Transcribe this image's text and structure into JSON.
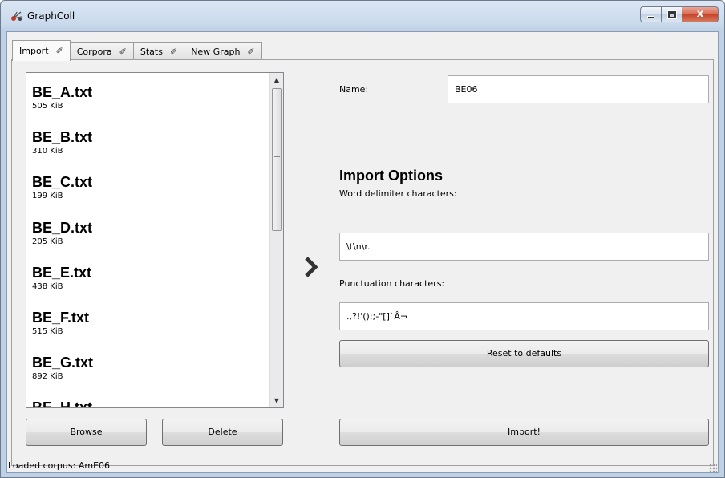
{
  "window": {
    "title": "GraphColl",
    "buttons": {
      "minimize": "minimize",
      "maximize": "maximize",
      "close": "x"
    },
    "accent_close": "#c5452b"
  },
  "tabs": [
    {
      "label": "Import",
      "active": true
    },
    {
      "label": "Corpora",
      "active": false
    },
    {
      "label": "Stats",
      "active": false
    },
    {
      "label": "New Graph",
      "active": false
    }
  ],
  "files": [
    {
      "name": "BE_A.txt",
      "size": "505 KiB"
    },
    {
      "name": "BE_B.txt",
      "size": "310 KiB"
    },
    {
      "name": "BE_C.txt",
      "size": "199 KiB"
    },
    {
      "name": "BE_D.txt",
      "size": "205 KiB"
    },
    {
      "name": "BE_E.txt",
      "size": "438 KiB"
    },
    {
      "name": "BE_F.txt",
      "size": "515 KiB"
    },
    {
      "name": "BE_G.txt",
      "size": "892 KiB"
    },
    {
      "name": "BE_H.txt",
      "size": ""
    }
  ],
  "buttons": {
    "browse": "Browse",
    "delete": "Delete",
    "reset": "Reset to defaults",
    "import": "Import!"
  },
  "form": {
    "name_label": "Name:",
    "name_value": "BE06",
    "section_title": "Import Options",
    "word_delim_label": "Word delimiter characters:",
    "word_delim_value": "\\t\\n\\r.",
    "punct_label": "Punctuation characters:",
    "punct_value": ".,?!'():;-\"[]`Â¬"
  },
  "status": "Loaded corpus: AmE06"
}
